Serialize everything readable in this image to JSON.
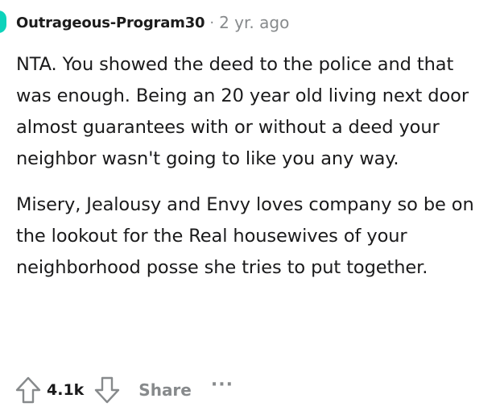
{
  "comment": {
    "author": "Outrageous-Program30",
    "separator": "·",
    "age": "2 yr. ago",
    "paragraphs": [
      "NTA. You showed the deed to the police and that was enough. Being an 20 year old living next door almost guarantees with or without a deed your neighbor wasn't going to like you any way.",
      "Misery, Jealousy and Envy loves company so be on the lookout for the Real housewives of your neighborhood posse she tries to put together."
    ],
    "score": "4.1k",
    "share_label": "Share",
    "more_label": "···"
  },
  "icons": {
    "upvote": "upvote-arrow-icon",
    "downvote": "downvote-arrow-icon"
  },
  "colors": {
    "avatar": "#0dd3bb",
    "muted": "#878a8c",
    "text": "#1a1a1b"
  }
}
